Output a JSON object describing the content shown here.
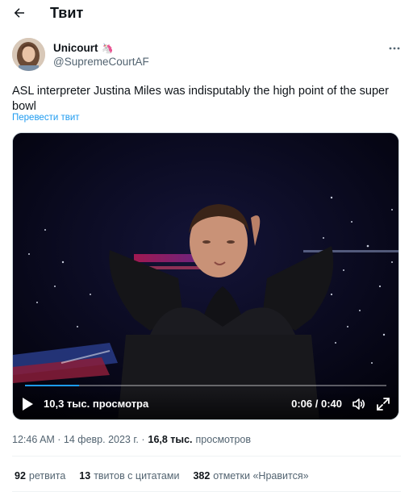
{
  "header": {
    "title": "Твит",
    "back_icon": "arrow-left-icon"
  },
  "author": {
    "display_name": "Unicourt",
    "emoji": "🦄",
    "handle": "@SupremeCourtAF",
    "more_icon": "more-horizontal-icon"
  },
  "tweet": {
    "text": "ASL interpreter Justina Miles was indisputably the high point of the super bowl",
    "translate_label": "Перевести твит"
  },
  "video": {
    "views_label": "10,3 тыс. просмотра",
    "time_label": "0:06 / 0:40",
    "progress": 0.15,
    "play_icon": "play-icon",
    "volume_icon": "volume-icon",
    "fullscreen_icon": "fullscreen-icon"
  },
  "meta": {
    "timestamp": "12:46 AM · 14 февр. 2023 г. ·",
    "views_count": "16,8 тыс.",
    "views_label": "просмотров"
  },
  "stats": {
    "retweets_count": "92",
    "retweets_label": "ретвита",
    "quotes_count": "13",
    "quotes_label": "твитов с цитатами",
    "likes_count": "382",
    "likes_label": "отметки «Нравится»"
  },
  "colors": {
    "link": "#1d9bf0",
    "secondary_text": "#536471",
    "primary_text": "#0f1419"
  }
}
